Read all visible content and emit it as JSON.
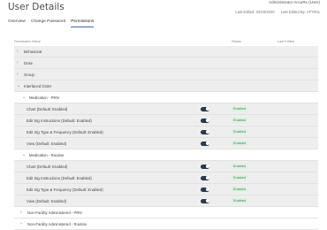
{
  "page": {
    "title": "User Details",
    "user_name": "Administrator AccuRx (User)",
    "last_edited_date": "Last Edited: 03/15/2020",
    "last_edited_by": "Last Edited By: AFY001"
  },
  "tabs": [
    {
      "label": "Overview",
      "active": false
    },
    {
      "label": "Change Password",
      "active": false
    },
    {
      "label": "Permissions",
      "active": true
    }
  ],
  "table": {
    "headers": {
      "name": "Permission Name",
      "status": "Status",
      "edited": "Last Edited"
    },
    "categories": [
      {
        "label": "Behavioral",
        "expanded": false
      },
      {
        "label": "Dose",
        "expanded": false
      },
      {
        "label": "Group",
        "expanded": false
      },
      {
        "label": "Interfaced Order",
        "expanded": true
      }
    ],
    "sections": [
      {
        "label": "Medication - PRN",
        "expanded": true,
        "items": [
          {
            "label": "Chart (Default: Enabled)",
            "status": "Enabled",
            "on": true
          },
          {
            "label": "Edit Sig Instructions (Default: Enabled)",
            "status": "Enabled",
            "on": true
          },
          {
            "label": "Edit Sig Type & Frequency (Default: Enabled)",
            "status": "Enabled",
            "on": true
          },
          {
            "label": "View (Default: Enabled)",
            "status": "Enabled",
            "on": true
          }
        ]
      },
      {
        "label": "Medication - Routine",
        "expanded": true,
        "items": [
          {
            "label": "Chart (Default: Enabled)",
            "status": "Enabled",
            "on": true
          },
          {
            "label": "Edit Sig Instructions (Default: Enabled)",
            "status": "Enabled",
            "on": true
          },
          {
            "label": "Edit Sig Type & Frequency (Default: Enabled)",
            "status": "Enabled",
            "on": true
          },
          {
            "label": "View (Default: Enabled)",
            "status": "Enabled",
            "on": true
          }
        ]
      }
    ],
    "bottom_rows": [
      {
        "label": "Non-Facility Administered - PRN",
        "expanded": false
      },
      {
        "label": "Non-Facility Administered - Routine",
        "expanded": false
      }
    ]
  },
  "icons": {
    "collapsed": "chevron-right-icon",
    "expanded": "chevron-down-icon"
  },
  "colors": {
    "accent": "#3a6ea5",
    "toggle_on": "#2b3a4a",
    "badge_bg": "#dff0e3",
    "badge_text": "#3a8a4f",
    "row_grey": "#eeeeee"
  }
}
